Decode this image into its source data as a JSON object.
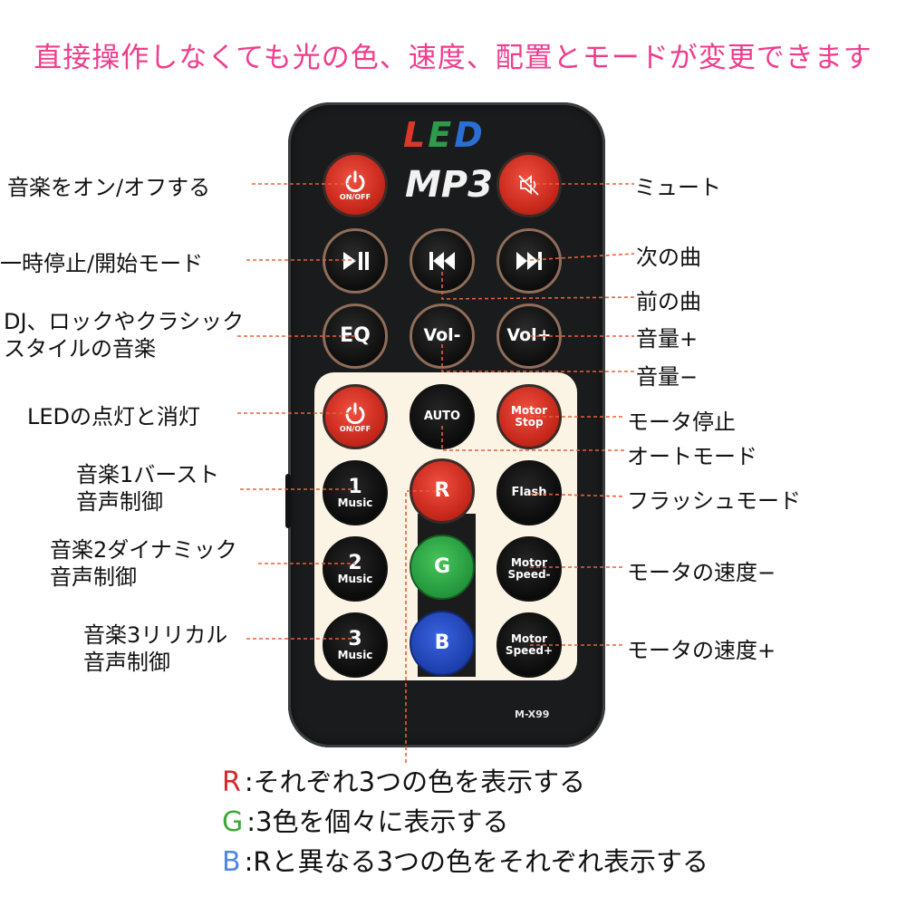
{
  "headline": "直接操作しなくても光の色、速度、配置とモードが変更できます",
  "remote": {
    "logo": [
      "L",
      "E",
      "D"
    ],
    "model_label": "MP3",
    "model_code": "M-X99",
    "buttons": {
      "power_caption": "ON/OFF",
      "eq": "EQ",
      "vol_minus": "Vol-",
      "vol_plus": "Vol+",
      "led_power_caption": "ON/OFF",
      "auto": "AUTO",
      "motor_stop": [
        "Motor",
        "Stop"
      ],
      "music1": [
        "1",
        "Music"
      ],
      "music2": [
        "2",
        "Music"
      ],
      "music3": [
        "3",
        "Music"
      ],
      "r": "R",
      "g": "G",
      "b": "B",
      "flash": "Flash",
      "motor_speed_minus": [
        "Motor",
        "Speed-"
      ],
      "motor_speed_plus": [
        "Motor",
        "Speed+"
      ]
    }
  },
  "labels": {
    "music_onoff": "音楽をオン/オフする",
    "mute": "ミュート",
    "pause_start": "一時停止/開始モード",
    "next": "次の曲",
    "prev": "前の曲",
    "style": [
      "DJ、ロックやクラシック",
      "スタイルの音楽"
    ],
    "vol_up": "音量+",
    "vol_down": "音量−",
    "led_onoff": "LEDの点灯と消灯",
    "motor_stop": "モータ停止",
    "auto_mode": "オートモード",
    "music1": [
      "音楽1バースト",
      "音声制御"
    ],
    "flash_mode": "フラッシュモード",
    "music2": [
      "音楽2ダイナミック",
      "音声制御"
    ],
    "speed_minus": "モータの速度−",
    "music3": [
      "音楽3リリカル",
      "音声制御"
    ],
    "speed_plus": "モータの速度+"
  },
  "legend": [
    {
      "key": "R",
      "color": "#d62828",
      "text": ":それぞれ3つの色を表示する"
    },
    {
      "key": "G",
      "color": "#3aa935",
      "text": ":3色を個々に表示する"
    },
    {
      "key": "B",
      "color": "#4f86e6",
      "text": ":Rと異なる3つの色をそれぞれ表示する"
    }
  ],
  "colors": {
    "headline": "#ef3d8d",
    "leader_line": "#e8603a",
    "remote_body": "#191b1c",
    "panel": "#fbf3e3"
  },
  "icons": [
    "power-icon",
    "mute-icon",
    "play-pause-icon",
    "previous-icon",
    "next-icon"
  ]
}
